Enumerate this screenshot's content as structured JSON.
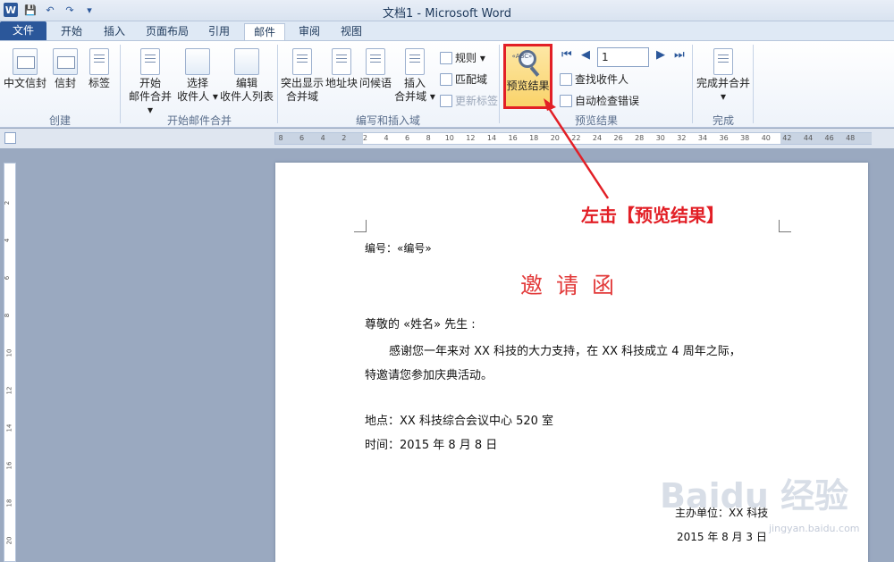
{
  "window": {
    "title": "文档1 - Microsoft Word"
  },
  "qat": {
    "logo": "W",
    "save": "💾",
    "undo": "↶",
    "redo": "↷",
    "customize": "▾"
  },
  "tabs": [
    "文件",
    "开始",
    "插入",
    "页面布局",
    "引用",
    "邮件",
    "审阅",
    "视图"
  ],
  "ribbon": {
    "create": {
      "label": "创建",
      "chinese_envelope": "中文信封",
      "envelope": "信封",
      "labels": "标签"
    },
    "start_merge": {
      "label": "开始邮件合并",
      "start": [
        "开始",
        "邮件合并 ▾"
      ],
      "select": [
        "选择",
        "收件人 ▾"
      ],
      "edit": [
        "编辑",
        "收件人列表"
      ]
    },
    "write_insert": {
      "label": "编写和插入域",
      "highlight": [
        "突出显示",
        "合并域"
      ],
      "address_block": "地址块",
      "greeting": "问候语",
      "insert_field": [
        "插入",
        "合并域 ▾"
      ],
      "rules": "规则 ▾",
      "match_fields": "匹配域",
      "update_labels": "更新标签"
    },
    "preview": {
      "label": "预览结果",
      "preview_button": "预览结果",
      "icon_text": "«ABC»",
      "record_number": "1",
      "find_recipient": "查找收件人",
      "auto_check": "自动检查错误"
    },
    "finish": {
      "label": "完成",
      "finish_merge": [
        "完成并合并",
        "▾"
      ]
    }
  },
  "ruler": {
    "ticks": [
      "8",
      "6",
      "4",
      "2",
      "2",
      "4",
      "6",
      "8",
      "10",
      "12",
      "14",
      "16",
      "18",
      "20",
      "22",
      "24",
      "26",
      "28",
      "30",
      "32",
      "34",
      "36",
      "38",
      "40",
      "42",
      "44",
      "46",
      "48"
    ],
    "vticks": [
      "2",
      "4",
      "6",
      "8",
      "10",
      "12",
      "14",
      "16",
      "18",
      "20"
    ]
  },
  "document": {
    "number_line": "编号：«编号»",
    "title": "邀请函",
    "salutation": "尊敬的 «姓名» 先生 :",
    "body_line1": "感谢您一年来对 XX 科技的大力支持，在 XX 科技成立 4 周年之际，",
    "body_line2": "特邀请您参加庆典活动。",
    "location": "地点：XX 科技综合会议中心 520 室",
    "time": "时间：2015 年 8 月 8 日",
    "organizer": "主办单位：XX 科技",
    "date": "2015 年 8 月 3 日"
  },
  "annotation": {
    "text": "左击【预览结果】",
    "color": "#e21f26"
  },
  "watermark": {
    "text": "Baidu 经验",
    "sub": "jingyan.baidu.com"
  },
  "colors": {
    "file_tab": "#2b579a",
    "title_red": "#e23b3b",
    "highlight": "#f9d36a"
  }
}
